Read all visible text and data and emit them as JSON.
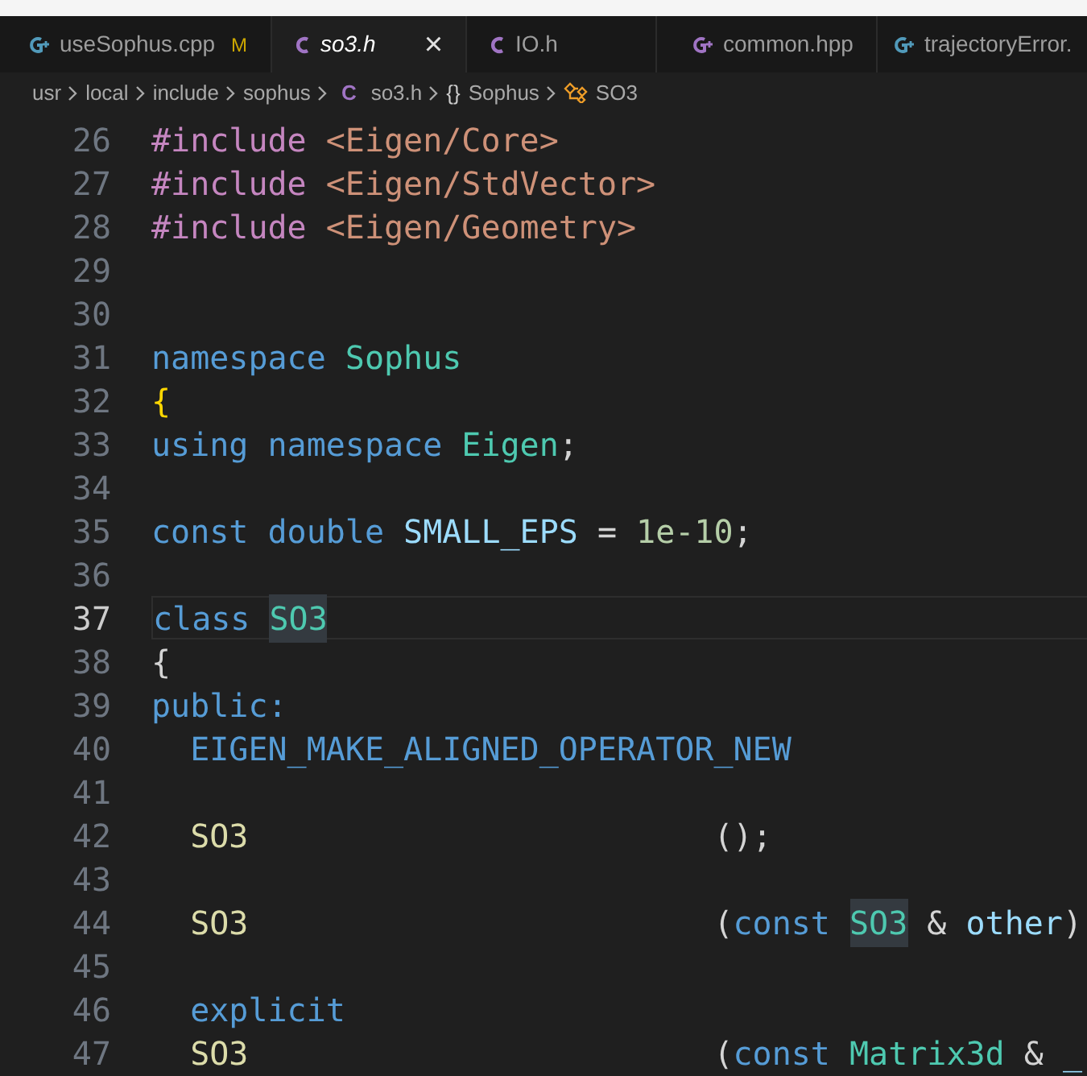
{
  "tabs": [
    {
      "label": "useSophus.cpp",
      "kind": "cpp",
      "badge": "M",
      "selected": false
    },
    {
      "label": "so3.h",
      "kind": "c",
      "selected": true
    },
    {
      "label": "IO.h",
      "kind": "c",
      "selected": false
    },
    {
      "label": "common.hpp",
      "kind": "hpp",
      "selected": false
    },
    {
      "label": "trajectoryError.",
      "kind": "cpp",
      "selected": false
    }
  ],
  "close_glyph": "×",
  "breadcrumb": [
    {
      "label": "usr",
      "kind": "folder"
    },
    {
      "label": "local",
      "kind": "folder"
    },
    {
      "label": "include",
      "kind": "folder"
    },
    {
      "label": "sophus",
      "kind": "folder"
    },
    {
      "label": "so3.h",
      "kind": "file",
      "icon_text": "C"
    },
    {
      "label": "Sophus",
      "kind": "namespace",
      "icon_text": "{}"
    },
    {
      "label": "SO3",
      "kind": "class"
    }
  ],
  "lines": [
    {
      "number": "26",
      "current": false,
      "tokens": [
        {
          "text": "#include",
          "kind": "directive"
        },
        {
          "text": " <Eigen/Core>",
          "kind": "string"
        }
      ]
    },
    {
      "number": "27",
      "current": false,
      "tokens": [
        {
          "text": "#include",
          "kind": "directive"
        },
        {
          "text": " <Eigen/StdVector>",
          "kind": "string"
        }
      ]
    },
    {
      "number": "28",
      "current": false,
      "tokens": [
        {
          "text": "#include",
          "kind": "directive"
        },
        {
          "text": " <Eigen/Geometry>",
          "kind": "string"
        }
      ]
    },
    {
      "number": "29",
      "current": false
    },
    {
      "number": "30",
      "current": false
    },
    {
      "number": "31",
      "current": false,
      "tokens": [
        {
          "text": "namespace",
          "kind": "keyword"
        },
        {
          "text": " Sophus",
          "kind": "type"
        }
      ]
    },
    {
      "number": "32",
      "current": false,
      "tokens": [
        {
          "text": "{",
          "kind": "bracket"
        }
      ]
    },
    {
      "number": "33",
      "current": false,
      "tokens": [
        {
          "text": "using namespace",
          "kind": "keyword"
        },
        {
          "text": " Eigen",
          "kind": "type"
        },
        {
          "text": ";",
          "kind": "plain"
        }
      ]
    },
    {
      "number": "34",
      "current": false
    },
    {
      "number": "35",
      "current": false,
      "tokens": [
        {
          "text": "const double",
          "kind": "keyword"
        },
        {
          "text": " SMALL_EPS",
          "kind": "variable"
        },
        {
          "text": " = ",
          "kind": "plain"
        },
        {
          "text": "1e-10",
          "kind": "number"
        },
        {
          "text": ";",
          "kind": "plain"
        }
      ]
    },
    {
      "number": "36",
      "current": false
    },
    {
      "number": "37",
      "current": true,
      "tokens": [
        {
          "text": "class ",
          "kind": "keyword"
        },
        {
          "text": "SO3",
          "kind": "type",
          "highlight": true
        }
      ]
    },
    {
      "number": "38",
      "current": false,
      "tokens": [
        {
          "text": "{",
          "kind": "plain"
        }
      ]
    },
    {
      "number": "39",
      "current": false,
      "tokens": [
        {
          "text": "public:",
          "kind": "keyword"
        }
      ]
    },
    {
      "number": "40",
      "current": false,
      "tokens": [
        {
          "text": "  EIGEN_MAKE_ALIGNED_OPERATOR_NEW",
          "kind": "macro"
        }
      ]
    },
    {
      "number": "41",
      "current": false
    },
    {
      "number": "42",
      "current": false,
      "tokens": [
        {
          "text": "  SO3",
          "kind": "function"
        },
        {
          "text": "                        ();",
          "kind": "plain"
        }
      ]
    },
    {
      "number": "43",
      "current": false
    },
    {
      "number": "44",
      "current": false,
      "tokens": [
        {
          "text": "  SO3",
          "kind": "function"
        },
        {
          "text": "                        (",
          "kind": "plain"
        },
        {
          "text": "const ",
          "kind": "keyword"
        },
        {
          "text": "SO3",
          "kind": "type",
          "highlight": true
        },
        {
          "text": " & ",
          "kind": "plain"
        },
        {
          "text": "other",
          "kind": "variable"
        },
        {
          "text": ")",
          "kind": "plain"
        }
      ]
    },
    {
      "number": "45",
      "current": false
    },
    {
      "number": "46",
      "current": false,
      "tokens": [
        {
          "text": "  explicit",
          "kind": "keyword"
        }
      ]
    },
    {
      "number": "47",
      "current": false,
      "tokens": [
        {
          "text": "  SO3",
          "kind": "function"
        },
        {
          "text": "                        (",
          "kind": "plain"
        },
        {
          "text": "const",
          "kind": "keyword"
        },
        {
          "text": " Matrix3d",
          "kind": "type"
        },
        {
          "text": " & ",
          "kind": "plain"
        },
        {
          "text": "_",
          "kind": "variable"
        }
      ]
    }
  ]
}
